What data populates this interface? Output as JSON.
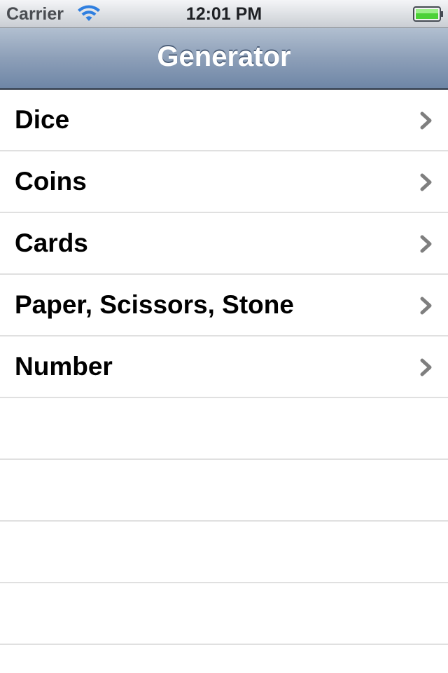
{
  "status_bar": {
    "carrier": "Carrier",
    "time": "12:01 PM",
    "wifi_icon": "wifi-icon",
    "battery_icon": "battery-icon",
    "battery_color": "#4cd137"
  },
  "nav_bar": {
    "title": "Generator"
  },
  "table": {
    "items": [
      {
        "label": "Dice",
        "icon": "chevron-right-icon"
      },
      {
        "label": "Coins",
        "icon": "chevron-right-icon"
      },
      {
        "label": "Cards",
        "icon": "chevron-right-icon"
      },
      {
        "label": "Paper, Scissors, Stone",
        "icon": "chevron-right-icon"
      },
      {
        "label": "Number",
        "icon": "chevron-right-icon"
      }
    ],
    "empty_rows": 5
  },
  "colors": {
    "nav_gradient_top": "#b1bfd0",
    "nav_gradient_bottom": "#6e86a6",
    "separator": "#e0e0e0",
    "chevron": "#7f7f7f"
  }
}
